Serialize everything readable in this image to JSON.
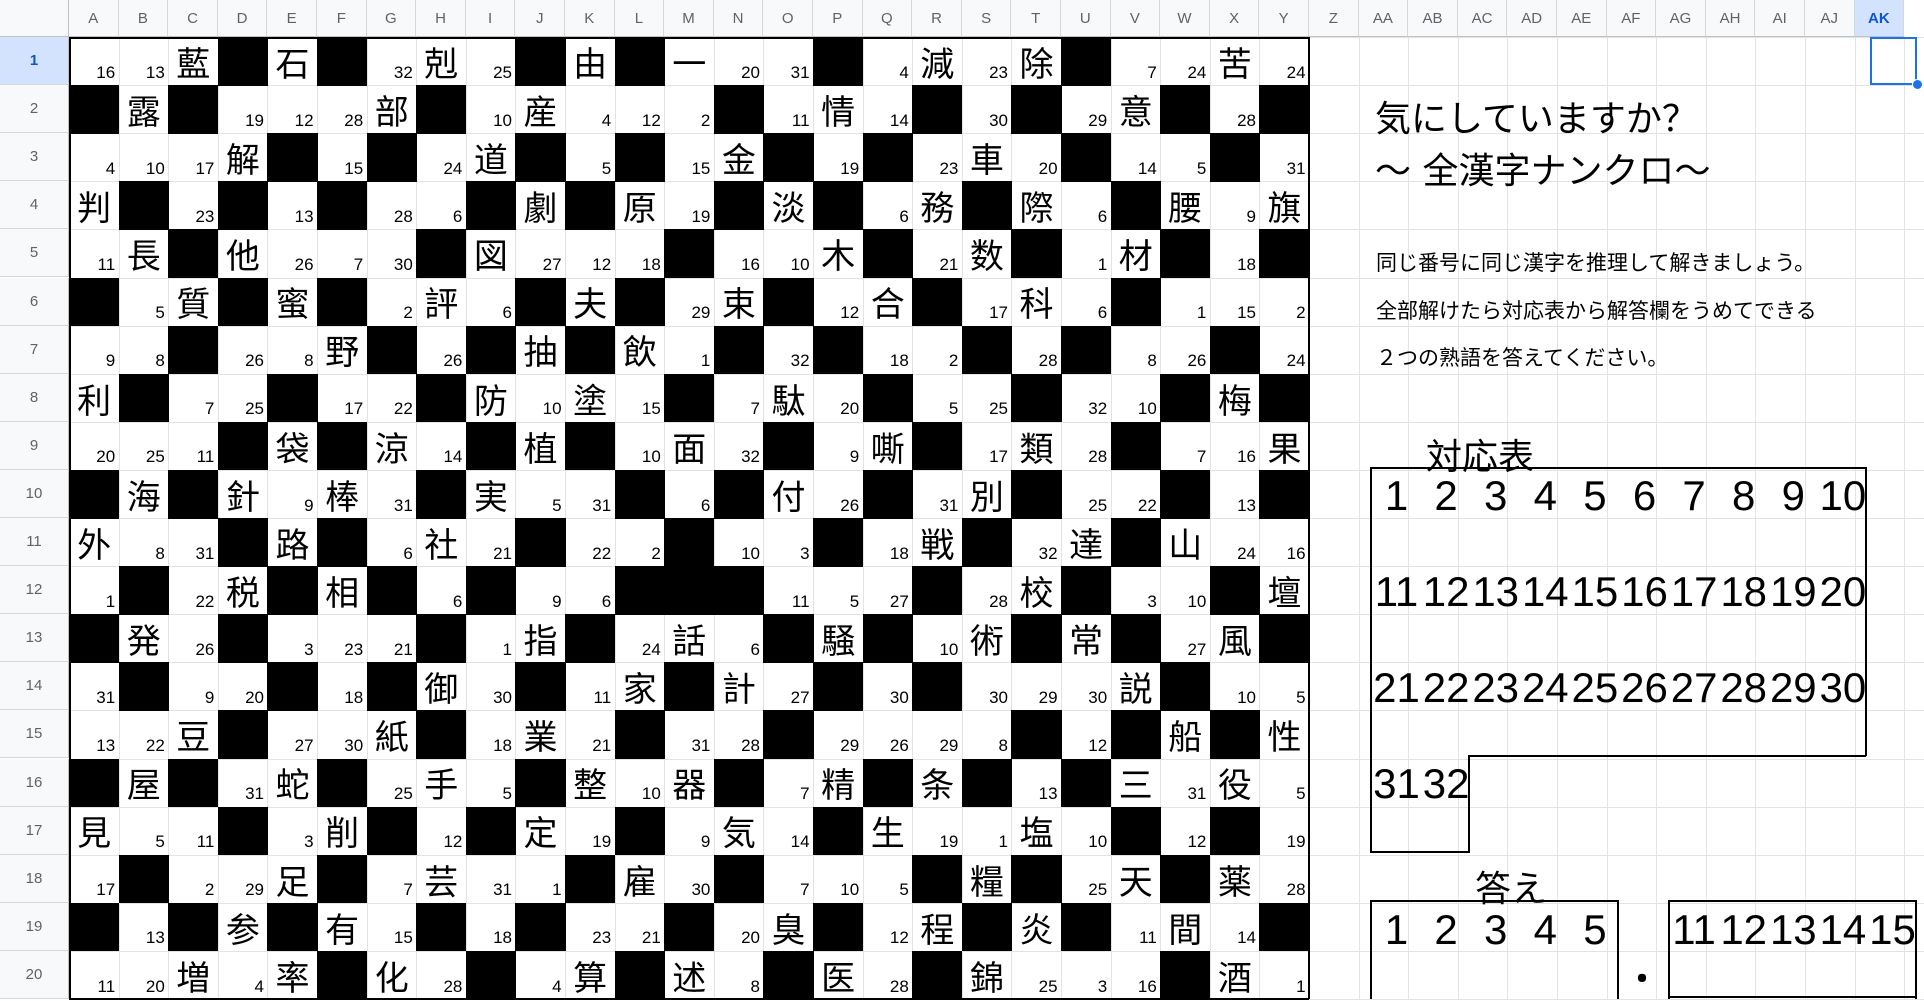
{
  "columns": [
    "A",
    "B",
    "C",
    "D",
    "E",
    "F",
    "G",
    "H",
    "I",
    "J",
    "K",
    "L",
    "M",
    "N",
    "O",
    "P",
    "Q",
    "R",
    "S",
    "T",
    "U",
    "V",
    "W",
    "X",
    "Y",
    "Z",
    "AA",
    "AB",
    "AC",
    "AD",
    "AE",
    "AF",
    "AG",
    "AH",
    "AI",
    "AJ",
    "AK"
  ],
  "rows": [
    "1",
    "2",
    "3",
    "4",
    "5",
    "6",
    "7",
    "8",
    "9",
    "10",
    "11",
    "12",
    "13",
    "14",
    "15",
    "16",
    "17",
    "18",
    "19",
    "20"
  ],
  "selected": {
    "col": "AK",
    "row": "1"
  },
  "grid": [
    [
      "16",
      "13",
      "藍",
      "#",
      "石",
      "#",
      "32",
      "剋",
      "25",
      "#",
      "由",
      "#",
      "一",
      "20",
      "31",
      "#",
      "4",
      "減",
      "23",
      "除",
      "#",
      "7",
      "24",
      "苦",
      "24"
    ],
    [
      "#",
      "露",
      "#",
      "19",
      "12",
      "28",
      "部",
      "#",
      "10",
      "産",
      "4",
      "12",
      "2",
      "#",
      "11",
      "情",
      "14",
      "#",
      "30",
      "#",
      "29",
      "意",
      "#",
      "28",
      "#"
    ],
    [
      "4",
      "10",
      "17",
      "解",
      "#",
      "15",
      "#",
      "24",
      "道",
      "#",
      "5",
      "#",
      "15",
      "金",
      "#",
      "19",
      "#",
      "23",
      "車",
      "20",
      "#",
      "14",
      "5",
      "#",
      "31"
    ],
    [
      "判",
      "#",
      "23",
      "#",
      "13",
      "#",
      "28",
      "6",
      "#",
      "劇",
      "#",
      "原",
      "19",
      "#",
      "淡",
      "#",
      "6",
      "務",
      "#",
      "際",
      "6",
      "#",
      "腰",
      "9",
      "旗"
    ],
    [
      "11",
      "長",
      "#",
      "他",
      "26",
      "7",
      "30",
      "#",
      "図",
      "27",
      "12",
      "18",
      "#",
      "16",
      "10",
      "木",
      "#",
      "21",
      "数",
      "#",
      "1",
      "材",
      "#",
      "18",
      "#"
    ],
    [
      "#",
      "5",
      "質",
      "#",
      "蜜",
      "#",
      "2",
      "評",
      "6",
      "#",
      "夫",
      "#",
      "29",
      "束",
      "#",
      "12",
      "合",
      "#",
      "17",
      "科",
      "6",
      "#",
      "1",
      "15",
      "2"
    ],
    [
      "9",
      "8",
      "#",
      "26",
      "8",
      "野",
      "#",
      "26",
      "#",
      "抽",
      "#",
      "飲",
      "1",
      "#",
      "32",
      "#",
      "18",
      "2",
      "#",
      "28",
      "#",
      "8",
      "26",
      "#",
      "24"
    ],
    [
      "利",
      "#",
      "7",
      "25",
      "#",
      "17",
      "22",
      "#",
      "防",
      "10",
      "塗",
      "15",
      "#",
      "7",
      "駄",
      "20",
      "#",
      "5",
      "25",
      "#",
      "32",
      "10",
      "#",
      "梅",
      "#"
    ],
    [
      "20",
      "25",
      "11",
      "#",
      "袋",
      "#",
      "涼",
      "14",
      "#",
      "植",
      "#",
      "10",
      "面",
      "32",
      "#",
      "9",
      "嘶",
      "#",
      "17",
      "類",
      "28",
      "#",
      "7",
      "16",
      "果"
    ],
    [
      "#",
      "海",
      "#",
      "針",
      "9",
      "棒",
      "31",
      "#",
      "実",
      "5",
      "31",
      "#",
      "6",
      "#",
      "付",
      "26",
      "#",
      "31",
      "別",
      "#",
      "25",
      "22",
      "#",
      "13",
      "#"
    ],
    [
      "外",
      "8",
      "31",
      "#",
      "路",
      "#",
      "6",
      "社",
      "21",
      "#",
      "22",
      "2",
      "#",
      "10",
      "3",
      "#",
      "18",
      "戦",
      "#",
      "32",
      "達",
      "#",
      "山",
      "24",
      "16"
    ],
    [
      "1",
      "#",
      "22",
      "税",
      "#",
      "相",
      "#",
      "6",
      "#",
      "9",
      "6",
      "#",
      "#",
      "#",
      "11",
      "5",
      "27",
      "#",
      "28",
      "校",
      "#",
      "3",
      "10",
      "#",
      "壇"
    ],
    [
      "#",
      "発",
      "26",
      "#",
      "3",
      "23",
      "21",
      "#",
      "1",
      "指",
      "#",
      "24",
      "話",
      "6",
      "#",
      "騒",
      "#",
      "10",
      "術",
      "#",
      "常",
      "#",
      "27",
      "風",
      "#"
    ],
    [
      "31",
      "#",
      "9",
      "20",
      "#",
      "18",
      "#",
      "御",
      "30",
      "#",
      "11",
      "家",
      "#",
      "計",
      "27",
      "#",
      "30",
      "#",
      "30",
      "29",
      "30",
      "説",
      "#",
      "10",
      "5"
    ],
    [
      "13",
      "22",
      "豆",
      "#",
      "27",
      "30",
      "紙",
      "#",
      "18",
      "業",
      "21",
      "#",
      "31",
      "28",
      "#",
      "29",
      "26",
      "29",
      "8",
      "#",
      "12",
      "#",
      "船",
      "#",
      "性"
    ],
    [
      "#",
      "屋",
      "#",
      "31",
      "蛇",
      "#",
      "25",
      "手",
      "5",
      "#",
      "整",
      "10",
      "器",
      "#",
      "7",
      "精",
      "#",
      "条",
      "#",
      "13",
      "#",
      "三",
      "31",
      "役",
      "5"
    ],
    [
      "見",
      "5",
      "11",
      "#",
      "3",
      "削",
      "#",
      "12",
      "#",
      "定",
      "19",
      "#",
      "9",
      "気",
      "14",
      "#",
      "生",
      "19",
      "1",
      "塩",
      "10",
      "#",
      "12",
      "#",
      "19"
    ],
    [
      "17",
      "#",
      "2",
      "29",
      "足",
      "#",
      "7",
      "芸",
      "31",
      "1",
      "#",
      "雇",
      "30",
      "#",
      "7",
      "10",
      "5",
      "#",
      "糧",
      "#",
      "25",
      "天",
      "#",
      "薬",
      "28"
    ],
    [
      "#",
      "13",
      "#",
      "参",
      "#",
      "有",
      "15",
      "#",
      "18",
      "#",
      "23",
      "21",
      "#",
      "20",
      "臭",
      "#",
      "12",
      "程",
      "#",
      "炎",
      "#",
      "11",
      "間",
      "14",
      "#"
    ],
    [
      "11",
      "20",
      "増",
      "4",
      "率",
      "#",
      "化",
      "28",
      "#",
      "4",
      "算",
      "#",
      "述",
      "8",
      "#",
      "医",
      "28",
      "#",
      "錦",
      "25",
      "3",
      "16",
      "#",
      "酒",
      "1"
    ]
  ],
  "title_line1": "気にしていますか？",
  "title_line2": "～ 全漢字ナンクロ～",
  "instruction1": "同じ番号に同じ漢字を推理して解きましょう。",
  "instruction2": "全部解けたら対応表から解答欄をうめてできる",
  "instruction3": "２つの熟語を答えてください。",
  "table_label": "対応表",
  "table_row1": [
    "1",
    "2",
    "3",
    "4",
    "5",
    "6",
    "7",
    "8",
    "9",
    "10"
  ],
  "table_row2": [
    "11",
    "12",
    "13",
    "14",
    "15",
    "16",
    "17",
    "18",
    "19",
    "20"
  ],
  "table_row3": [
    "21",
    "22",
    "23",
    "24",
    "25",
    "26",
    "27",
    "28",
    "29",
    "30"
  ],
  "table_row4": [
    "31",
    "32"
  ],
  "answer_label": "答え",
  "answer_first": [
    "1",
    "2",
    "3",
    "4",
    "5"
  ],
  "answer_dot": "・",
  "answer_second": [
    "11",
    "12",
    "13",
    "14",
    "15"
  ]
}
